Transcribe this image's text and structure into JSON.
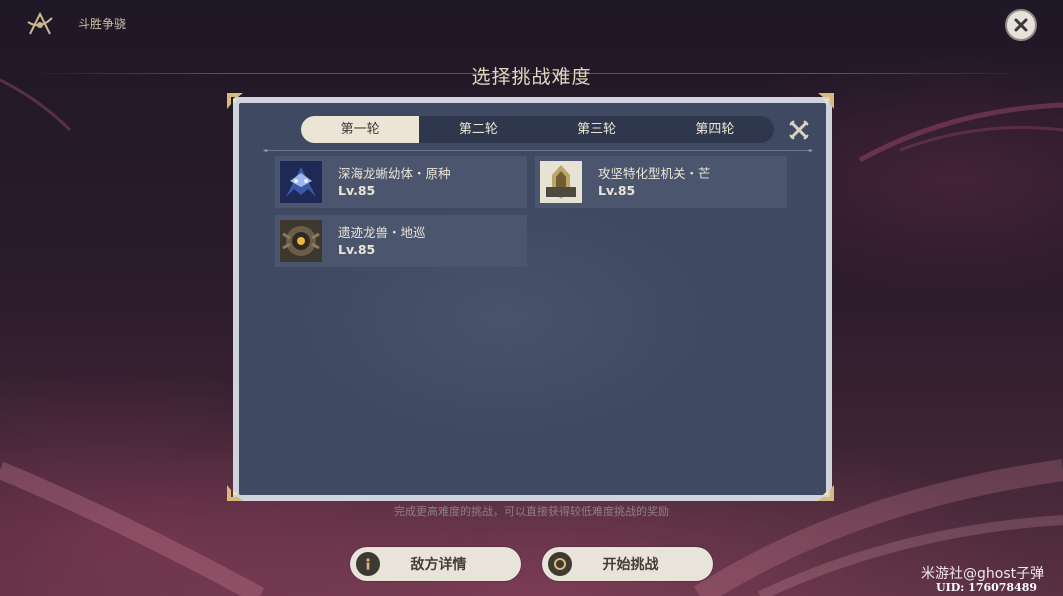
{
  "header": {
    "mode_title": "斗胜争骁",
    "screen_title": "选择挑战难度",
    "close_icon": "close-icon"
  },
  "tabs": [
    {
      "label": "第一轮",
      "active": true
    },
    {
      "label": "第二轮",
      "active": false
    },
    {
      "label": "第三轮",
      "active": false
    },
    {
      "label": "第四轮",
      "active": false
    }
  ],
  "enemies": [
    {
      "name": "深海龙蜥幼体・原种",
      "level": "Lv.85",
      "portrait": "deep-sea-dragonspawn-portrait"
    },
    {
      "name": "攻坚特化型机关・芒",
      "level": "Lv.85",
      "portrait": "construct-portrait"
    },
    {
      "name": "遗迹龙兽・地巡",
      "level": "Lv.85",
      "portrait": "ruin-drake-portrait"
    }
  ],
  "hint": "完成更高难度的挑战，可以直接获得较低难度挑战的奖励",
  "buttons": {
    "enemy_details": "敌方详情",
    "start_challenge": "开始挑战"
  },
  "watermark": {
    "text": "米游社@ghost子弹",
    "uid": "UID: 176078489"
  },
  "colors": {
    "panel_bg": "#3f4a62",
    "card_bg": "#4b566e",
    "accent_gold": "#d8b978",
    "tab_active": "#ece5d6"
  }
}
